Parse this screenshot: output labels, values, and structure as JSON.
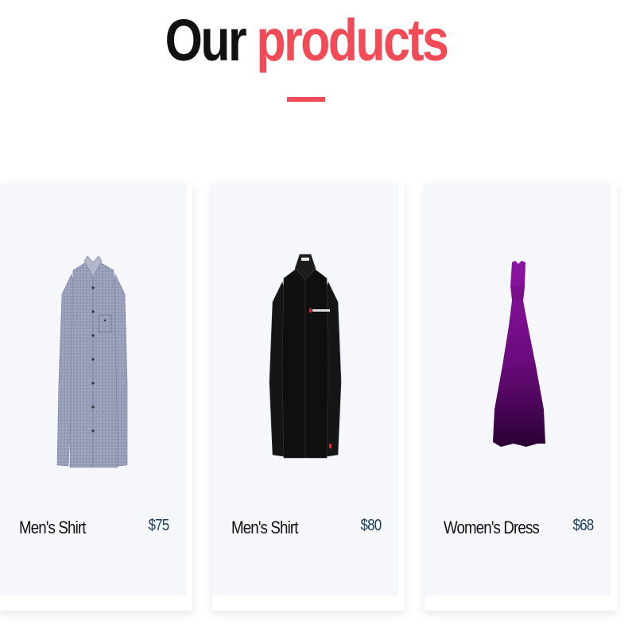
{
  "section": {
    "title_word1": "Our",
    "title_word2": "products",
    "accent_color": "#f04b57"
  },
  "products": [
    {
      "name": "Men's Shirt",
      "price": "$75",
      "image": "grey-dress-shirt"
    },
    {
      "name": "Men's Shirt",
      "price": "$80",
      "image": "black-dress-shirt"
    },
    {
      "name": "Women's Dress",
      "price": "$68",
      "image": "purple-gown"
    }
  ]
}
